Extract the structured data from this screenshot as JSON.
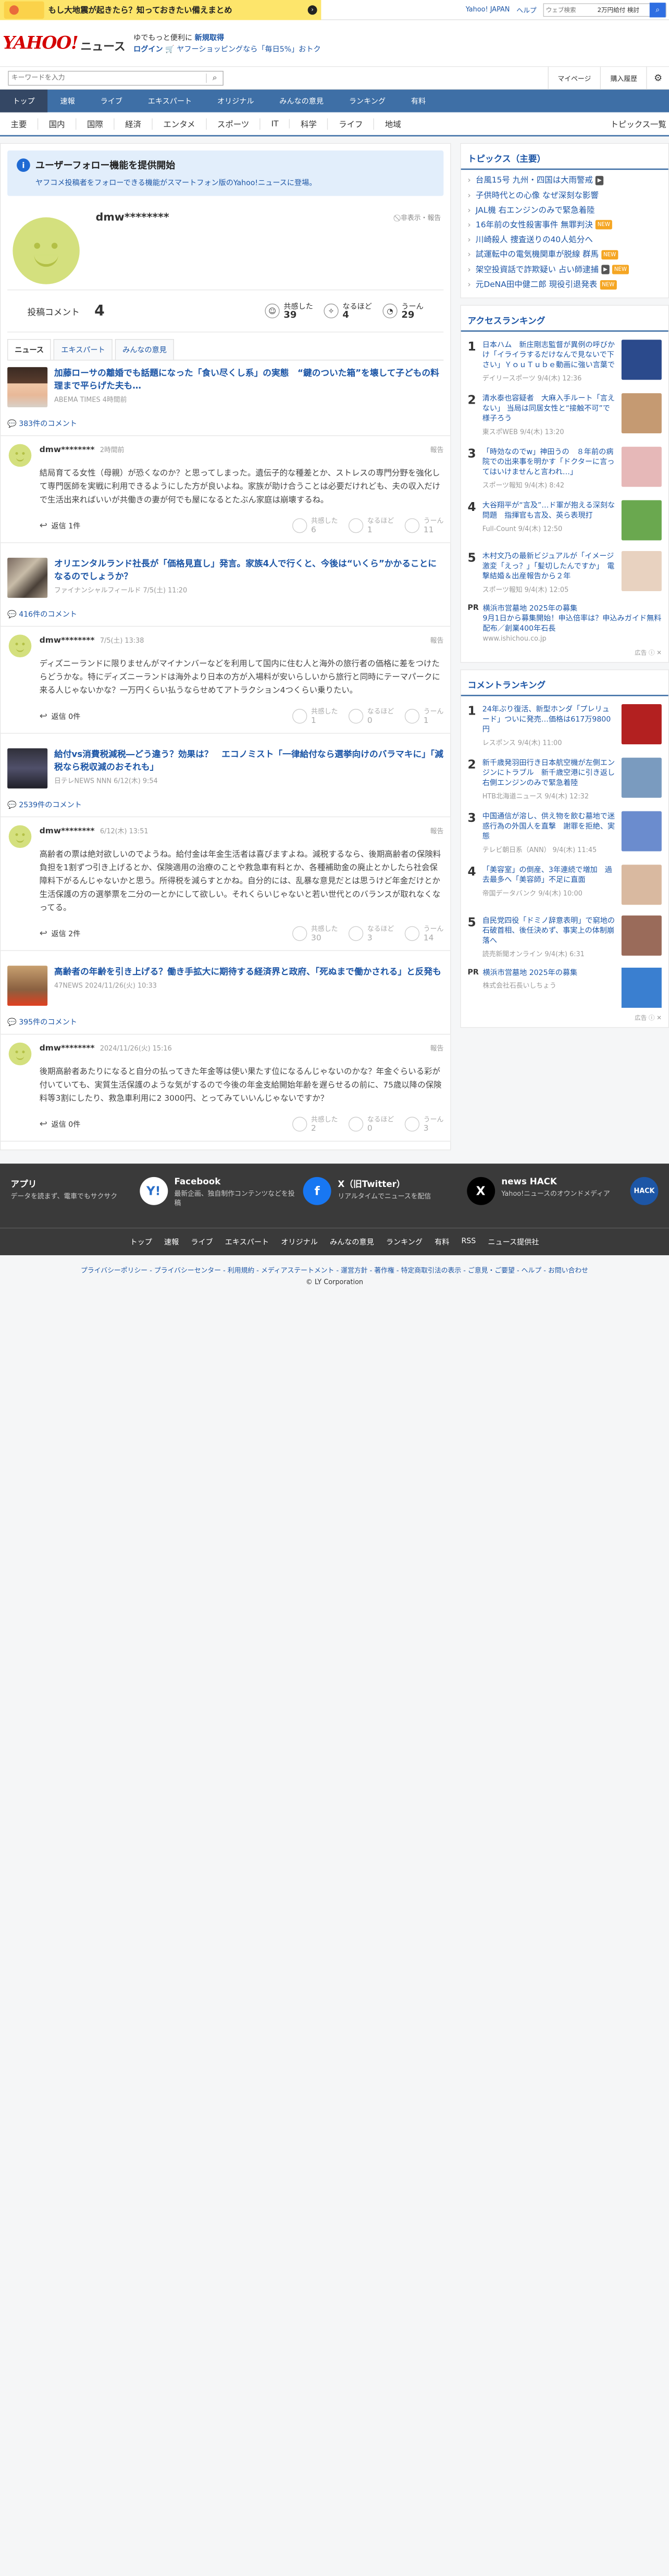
{
  "topbar": {
    "ad_text": "もし大地震が起きたら？知っておきたい備えまとめ",
    "links": [
      "Yahoo! JAPAN",
      "ヘルプ"
    ],
    "search_placeholder": "ウェブ検索",
    "search_sample": "2万円給付 検討"
  },
  "header": {
    "logo": "YAHOO!",
    "logo_sub": "JAPAN",
    "news": "ニュース",
    "line1_a": "ゆでもっと便利に",
    "line1_b": "新規取得",
    "line2_a": "ログイン",
    "line2_b": "ヤフーショッピングなら「毎日5%」おトク"
  },
  "search": {
    "placeholder": "キーワードを入力",
    "mypage": "マイページ",
    "history": "購入履歴"
  },
  "gnav": [
    "トップ",
    "速報",
    "ライブ",
    "エキスパート",
    "オリジナル",
    "みんなの意見",
    "ランキング",
    "有料"
  ],
  "cnav": [
    "主要",
    "国内",
    "国際",
    "経済",
    "エンタメ",
    "スポーツ",
    "IT",
    "科学",
    "ライフ",
    "地域"
  ],
  "cnav_right": "トピックス一覧",
  "notice": {
    "title": "ユーザーフォロー機能を提供開始",
    "desc": "ヤフコメ投稿者をフォローできる機能がスマートフォン版のYahoo!ニュースに登場。"
  },
  "profile": {
    "name": "dmw********",
    "report": "非表示・報告"
  },
  "stats": {
    "label": "投稿コメント",
    "count": "4",
    "empathy_label": "共感した",
    "empathy": "39",
    "naruhodo_label": "なるほど",
    "naruhodo": "4",
    "uun_label": "うーん",
    "uun": "29"
  },
  "tabs": [
    "ニュース",
    "エキスパート",
    "みんなの意見"
  ],
  "articles": [
    {
      "title": "加藤ローサの離婚でも話題になった「食い尽くし系」の実態　“鍵のついた箱”を壊して子どもの料理まで平らげた夫も…",
      "source": "ABEMA TIMES",
      "time": "4時間前",
      "count": "383件のコメント",
      "c_user": "dmw********",
      "c_time": "2時間前",
      "c_report": "報告",
      "c_text": "結局育てる女性（母親）が恐くなのか？と思ってしまった。遺伝子的な種差とか、ストレスの専門分野を強化して専門医師を実戦に利用できるようにした方が良いよね。家族が助け合うことは必要だけれども、夫の収入だけで生活出来ればいいが共働きの妻が何でも屋になるとたぶん家庭は崩壊するね。",
      "reply": "返信 1件",
      "e": "6",
      "n": "1",
      "u": "11"
    },
    {
      "title": "オリエンタルランド社長が「価格見直し」発言。家族4人で行くと、今後は“いくら”かかることになるのでしょうか？",
      "source": "ファイナンシャルフィールド",
      "time": "7/5(土) 11:20",
      "count": "416件のコメント",
      "c_user": "dmw********",
      "c_time": "7/5(土) 13:38",
      "c_report": "報告",
      "c_text": "ディズニーランドに限りませんがマイナンバーなどを利用して国内に住む人と海外の旅行者の価格に差をつけたらどうかな。特にディズニーランドは海外より日本の方が入場料が安いらしいから旅行と同時にテーマパークに来る人じゃないかな？一万円くらい払うならせめてアトラクション4つくらい乗りたい。",
      "reply": "返信 0件",
      "e": "1",
      "n": "0",
      "u": "1"
    },
    {
      "title": "給付vs消費税減税―どう違う？効果は？　エコノミスト「一律給付なら選挙向けのバラマキに」「減税なら税収減のおそれも」",
      "source": "日テレNEWS NNN",
      "time": "6/12(木) 9:54",
      "count": "2539件のコメント",
      "c_user": "dmw********",
      "c_time": "6/12(木) 13:51",
      "c_report": "報告",
      "c_text": "高齢者の票は絶対欲しいのでようね。給付金は年金生活者は喜びますよね。減税するなら、後期高齢者の保険料負担を1割ずつ引き上げるとか、保険適用の治療のことや救急車有料とか、各種補助金の廃止とかしたら社会保障料下がるんじゃないかと思う。所得税を減らすとかね。自分的には、乱暴な意見だとは思うけど年金だけとか生活保護の方の選挙票を二分の一とかにして欲しい。それくらいじゃないと若い世代とのバランスが取れなくなってる。",
      "reply": "返信 2件",
      "e": "30",
      "n": "3",
      "u": "14"
    },
    {
      "title": "高齢者の年齢を引き上げる？働き手拡大に期待する経済界と政府、「死ぬまで働かされる」と反発も",
      "source": "47NEWS",
      "time": "2024/11/26(火) 10:33",
      "count": "395件のコメント",
      "c_user": "dmw********",
      "c_time": "2024/11/26(火) 15:16",
      "c_report": "報告",
      "c_text": "後期高齢者あたりになると自分の払ってきた年金等は使い果たす位になるんじゃないのかな？年金ぐらいる彩が付いていても、実質生活保護のような気がするので今後の年金支給開始年齢を遅らせるの前に、75歳以降の保険料等3割にしたり、救急車利用に2 3000円、とってみていいんじゃないですか？",
      "reply": "返信 0件",
      "e": "2",
      "n": "0",
      "u": "3"
    }
  ],
  "reaction_labels": {
    "e": "共感した",
    "n": "なるほど",
    "u": "うーん"
  },
  "side": {
    "topics_title": "トピックス（主要）",
    "topics": [
      {
        "t": "台風15号 九州・四国は大雨警戒",
        "tag": "vid"
      },
      {
        "t": "子供時代との心像 なぜ深刻な影響",
        "tag": ""
      },
      {
        "t": "JAL機 右エンジンのみで緊急着陸",
        "tag": ""
      },
      {
        "t": "16年前の女性殺害事件 無罪判決",
        "tag": "new"
      },
      {
        "t": "川崎殺人 捜査送りの40人処分へ",
        "tag": ""
      },
      {
        "t": "試運転中の電気機関車が脱線 群馬",
        "tag": "new"
      },
      {
        "t": "架空投資話で詐欺疑い 占い師逮捕",
        "tag": "vidnew"
      },
      {
        "t": "元DeNA田中健二郎 現役引退発表",
        "tag": "new"
      }
    ],
    "tag_new": "NEW",
    "tag_vid": "▶",
    "access_title": "アクセスランキング",
    "access": [
      {
        "t": "日本ハム　新庄剛志監督が異例の呼びかけ「イライラするだけなんで見ないで下さい」ＹｏｕＴｕｂｅ動画に強い言葉で",
        "s": "デイリースポーツ 9/4(木) 12:36",
        "c": "#2b4a8c"
      },
      {
        "t": "清水泰也容疑者　大麻入手ルート「言えない」 当局は同居女性と“接触不可”で様子ろう",
        "s": "東スポWEB 9/4(木) 13:20",
        "c": "#c59a72"
      },
      {
        "t": "「時効なのでw」神田うの　８年前の病院での出来事を明かす「ドクターに言ってはいけませんと言われ…」",
        "s": "スポーツ報知 9/4(木) 8:42",
        "c": "#e6b8b8"
      },
      {
        "t": "大谷翔平が“言及”…ド軍が抱える深刻な問題　指揮官も言及、英ら表現打",
        "s": "Full-Count 9/4(木) 12:50",
        "c": "#6aa84f"
      },
      {
        "t": "木村文乃の最新ビジュアルが「イメージ激変「えっ？」「髪切したんですか」　電撃結婚＆出産報告から２年",
        "s": "スポーツ報知 9/4(木) 12:05",
        "c": "#e8d2c0"
      }
    ],
    "pr1": {
      "p": "PR",
      "t": "横浜市営墓地 2025年の募集",
      "t2": "9月1日から募集開始！申込倍率は？申込みガイド無料配布／創業400年石長",
      "s": "www.ishichou.co.jp"
    },
    "ad_label": "広告",
    "comment_title": "コメントランキング",
    "comments": [
      {
        "t": "24年ぶり復活、新型ホンダ「プレリュード」ついに発売…価格は617万9800円",
        "s": "レスポンス 9/4(木) 11:00",
        "c": "#b32020"
      },
      {
        "t": "新千歳発羽田行き日本航空機が左側エンジンにトラブル　新千歳空港に引き返し右側エンジンのみで緊急着陸",
        "s": "HTB北海道ニュース 9/4(木) 12:32",
        "c": "#7a9bbf"
      },
      {
        "t": "中国通信が溶し、供え物を飲む墓地で迷惑行為の外国人を直撃　謝罪を拒絶、実態",
        "s": "テレビ朝日系（ANN） 9/4(木) 11:45",
        "c": "#6b8cce"
      },
      {
        "t": "「美容室」の倒産、3年連続で増加　過去最多へ「美容師」不足に直面",
        "s": "帝国データバンク 9/4(木) 10:00",
        "c": "#d9b9a0"
      },
      {
        "t": "自民党四役「ドミノ辞意表明」で窮地の石破首相、後任決めず、事実上の体制崩落へ",
        "s": "読売新聞オンライン 9/4(木) 6:31",
        "c": "#9a6b5a"
      }
    ],
    "pr2": {
      "p": "PR",
      "t": "横浜市営墓地 2025年の募集",
      "s": "株式会社石長いしちょう"
    }
  },
  "footer": {
    "apps": [
      {
        "nm": "アプリ",
        "ds": "データを読まず、電車でもサクサク",
        "lg": "Y!",
        "c": "#fff",
        "fc": "#2a6fc9"
      },
      {
        "nm": "Facebook",
        "ds": "最新企画、独自制作コンテンツなどを投稿",
        "lg": "f",
        "c": "#1877f2",
        "fc": "#fff"
      },
      {
        "nm": "X（旧Twitter）",
        "ds": "リアルタイムでニュースを配信",
        "lg": "X",
        "c": "#000",
        "fc": "#fff"
      },
      {
        "nm": "news HACK",
        "ds": "Yahoo!ニュースのオウンドメディア",
        "lg": "HACK",
        "c": "#1d56a6",
        "fc": "#fff"
      }
    ],
    "nav": [
      "トップ",
      "速報",
      "ライブ",
      "エキスパート",
      "オリジナル",
      "みんなの意見",
      "ランキング",
      "有料",
      "RSS",
      "ニュース提供社"
    ],
    "links": "プライバシーポリシー - プライバシーセンター - 利用規約 - メディアステートメント - 運営方針 - 著作権 - 特定商取引法の表示 - ご意見・ご要望 - ヘルプ - お問い合わせ",
    "copy": "© LY Corporation"
  }
}
